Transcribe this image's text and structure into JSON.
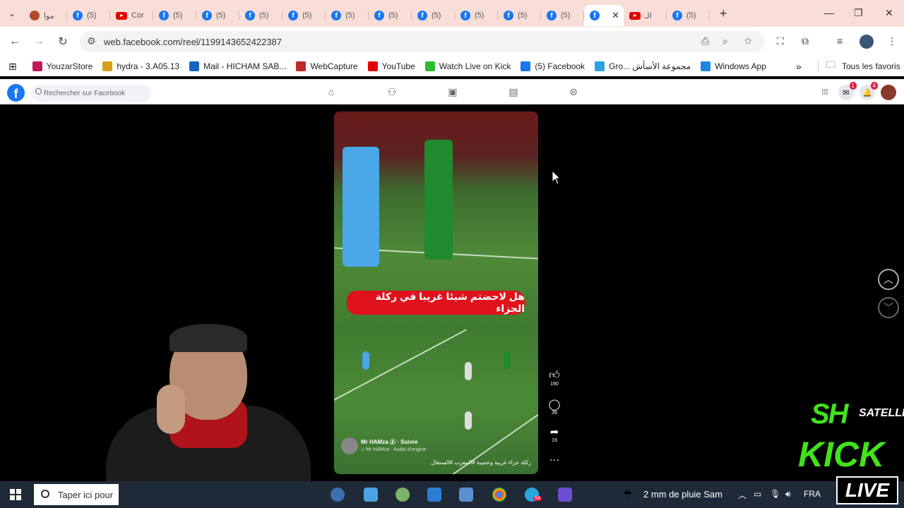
{
  "browser": {
    "tabs": [
      {
        "title": "موا",
        "icon": "site-icon",
        "active": false
      },
      {
        "title": "(5)",
        "icon": "facebook-icon",
        "active": false
      },
      {
        "title": "Cor",
        "icon": "youtube-icon",
        "active": false
      },
      {
        "title": "(5)",
        "icon": "facebook-icon",
        "active": false
      },
      {
        "title": "(5)",
        "icon": "facebook-icon",
        "active": false
      },
      {
        "title": "(5)",
        "icon": "facebook-icon",
        "active": false
      },
      {
        "title": "(5)",
        "icon": "facebook-icon",
        "active": false
      },
      {
        "title": "(5)",
        "icon": "facebook-icon",
        "active": false
      },
      {
        "title": "(5)",
        "icon": "facebook-icon",
        "active": false
      },
      {
        "title": "(5)",
        "icon": "facebook-icon",
        "active": false
      },
      {
        "title": "(5)",
        "icon": "facebook-icon",
        "active": false
      },
      {
        "title": "(5)",
        "icon": "facebook-icon",
        "active": false
      },
      {
        "title": "(5)",
        "icon": "facebook-icon",
        "active": false
      },
      {
        "title": "",
        "icon": "facebook-icon",
        "active": true
      },
      {
        "title": "الـ",
        "icon": "youtube-icon",
        "active": false
      },
      {
        "title": "(5)",
        "icon": "facebook-icon",
        "active": false
      }
    ],
    "url": "web.facebook.com/reel/1199143652422387"
  },
  "bookmarks": [
    {
      "label": "YouzarStore",
      "color": "#c2185b"
    },
    {
      "label": "hydra - 3.A05.13",
      "color": "#d4a017"
    },
    {
      "label": "Mail - HICHAM SAB...",
      "color": "#1565c0"
    },
    {
      "label": "WebCapture",
      "color": "#c62828"
    },
    {
      "label": "YouTube",
      "color": "#e60000"
    },
    {
      "label": "Watch Live on Kick",
      "color": "#2ebd2e"
    },
    {
      "label": "(5) Facebook",
      "color": "#1877f2"
    },
    {
      "label": "Gro... مجموعة الأسأش",
      "color": "#2aa3df"
    },
    {
      "label": "Windows App",
      "color": "#1e88e5"
    }
  ],
  "bookmarks_all": "Tous les favoris",
  "facebook": {
    "search_placeholder": "Rechercher sur Facebook",
    "messenger_badge": "1",
    "notifications_badge": "4"
  },
  "reel": {
    "banner_text": "هل لاحضتم شيئا غريبا في ركلة الجزاء",
    "author": "Mr HAMza ⓖ · Suivre",
    "audio": "♫ Mr HAMza · Audio d'origine",
    "caption": "ركلة جزاء غريبة وعجيبة #المغرب #السنغال",
    "likes": "190",
    "comments": "39",
    "shares": "19"
  },
  "taskbar": {
    "search_placeholder": "Taper ici pour",
    "weather": "2 mm de pluie Sam",
    "lang": "FRA",
    "telegram_badge": "54"
  },
  "overlay": {
    "sh": "SH",
    "satellite": "SATELLITE",
    "kick": "KICK",
    "live": "LIVE"
  }
}
